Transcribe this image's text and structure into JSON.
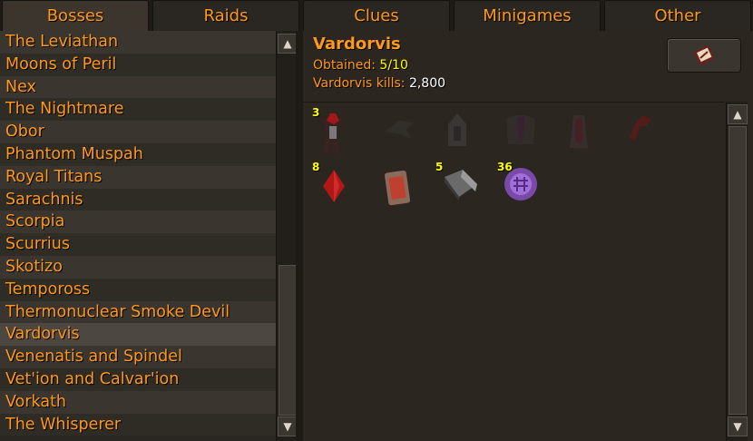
{
  "tabs": [
    {
      "label": "Bosses"
    },
    {
      "label": "Raids"
    },
    {
      "label": "Clues"
    },
    {
      "label": "Minigames"
    },
    {
      "label": "Other"
    }
  ],
  "boss_list": [
    "The Leviathan",
    "Moons of Peril",
    "Nex",
    "The Nightmare",
    "Obor",
    "Phantom Muspah",
    "Royal Titans",
    "Sarachnis",
    "Scorpia",
    "Scurrius",
    "Skotizo",
    "Tempoross",
    "Thermonuclear Smoke Devil",
    "Vardorvis",
    "Venenatis and Spindel",
    "Vet'ion and Calvar'ion",
    "Vorkath",
    "The Whisperer"
  ],
  "selected_boss": "Vardorvis",
  "detail": {
    "title": "Vardorvis",
    "obtained_label": "Obtained: ",
    "obtained_value": "5/10",
    "kills_label": "Vardorvis kills: ",
    "kills_value": "2,800"
  },
  "items": [
    {
      "icon": "pet-vardorvis-icon",
      "qty": "3",
      "obtained": true
    },
    {
      "icon": "ultor-vestige-icon",
      "qty": "",
      "obtained": false
    },
    {
      "icon": "virtus-mask-icon",
      "qty": "",
      "obtained": false
    },
    {
      "icon": "virtus-robe-top-icon",
      "qty": "",
      "obtained": false
    },
    {
      "icon": "virtus-robe-bottom-icon",
      "qty": "",
      "obtained": false
    },
    {
      "icon": "executioners-axe-head-icon",
      "qty": "",
      "obtained": false
    },
    {
      "icon": "blood-quartz-icon",
      "qty": "8",
      "obtained": true
    },
    {
      "icon": "strangled-tablet-icon",
      "qty": "",
      "obtained": true
    },
    {
      "icon": "chromium-ingot-icon",
      "qty": "5",
      "obtained": true
    },
    {
      "icon": "awakeners-orb-icon",
      "qty": "36",
      "obtained": true
    }
  ]
}
